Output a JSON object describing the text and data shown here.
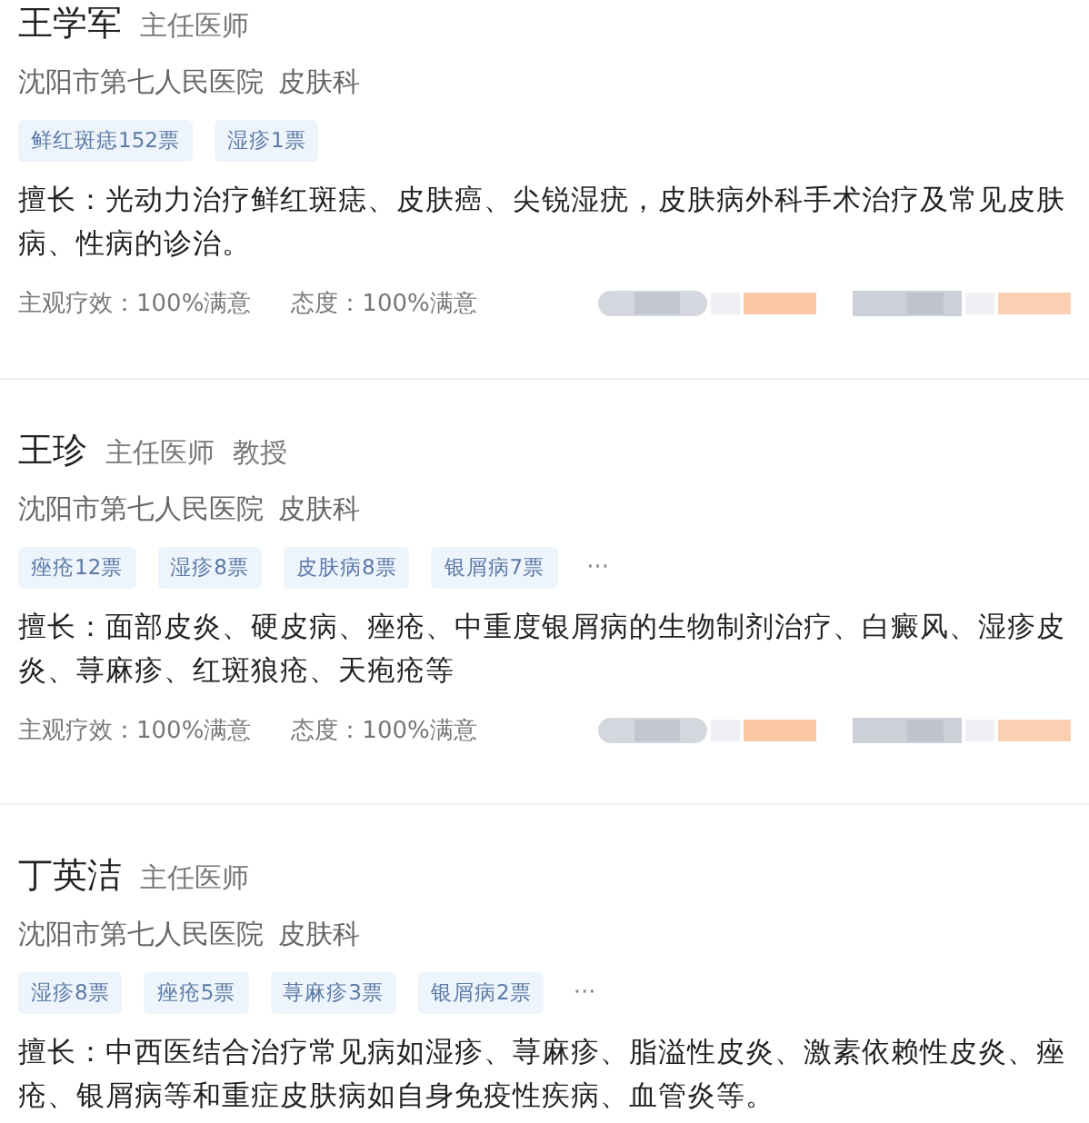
{
  "doctors": [
    {
      "name": "王学军",
      "title": "主任医师",
      "hospital": "沈阳市第七人民医院",
      "department": "皮肤科",
      "tags": [
        "鲜红斑痣152票",
        "湿疹1票"
      ],
      "specialty": "擅长：光动力治疗鲜红斑痣、皮肤癌、尖锐湿疣，皮肤病外科手术治疗及常见皮肤病、性病的诊治。",
      "efficacy": "主观疗效：100%满意",
      "attitude": "态度：100%满意"
    },
    {
      "name": "王珍",
      "title": "主任医师",
      "title2": "教授",
      "hospital": "沈阳市第七人民医院",
      "department": "皮肤科",
      "tags": [
        "痤疮12票",
        "湿疹8票",
        "皮肤病8票",
        "银屑病7票"
      ],
      "more": "···",
      "specialty": "擅长：面部皮炎、硬皮病、痤疮、中重度银屑病的生物制剂治疗、白癜风、湿疹皮炎、荨麻疹、红斑狼疮、天疱疮等",
      "efficacy": "主观疗效：100%满意",
      "attitude": "态度：100%满意"
    },
    {
      "name": "丁英洁",
      "title": "主任医师",
      "hospital": "沈阳市第七人民医院",
      "department": "皮肤科",
      "tags": [
        "湿疹8票",
        "痤疮5票",
        "荨麻疹3票",
        "银屑病2票"
      ],
      "more": "···",
      "specialty": "擅长：中西医结合治疗常见病如湿疹、荨麻疹、脂溢性皮炎、激素依赖性皮炎、痤疮、银屑病等和重症皮肤病如自身免疫性疾病、血管炎等。"
    }
  ]
}
